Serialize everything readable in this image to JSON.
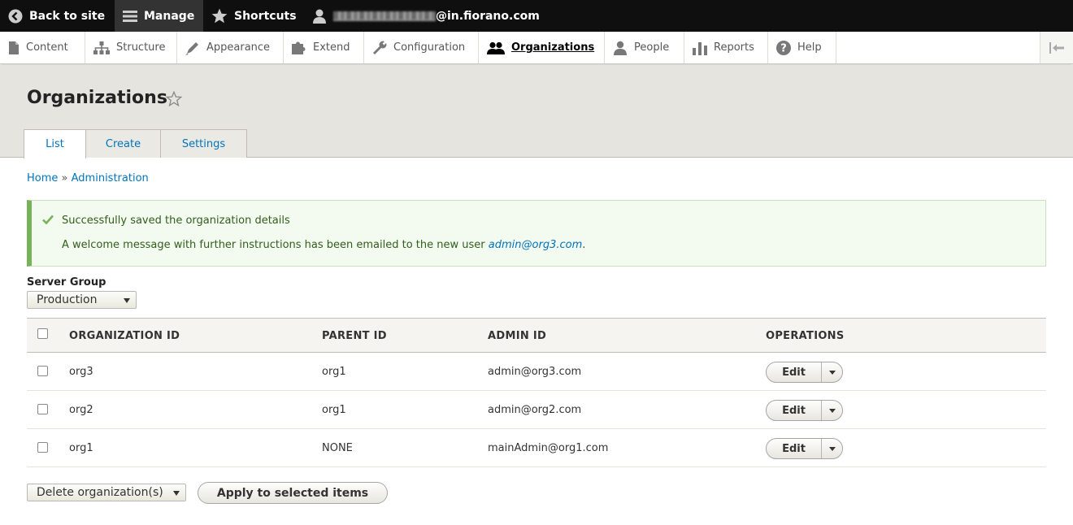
{
  "toolbar": {
    "back_label": "Back to site",
    "manage_label": "Manage",
    "shortcuts_label": "Shortcuts",
    "user_suffix": "@in.fiorano.com"
  },
  "tray": {
    "items": [
      {
        "label": "Content",
        "icon": "file-icon"
      },
      {
        "label": "Structure",
        "icon": "sitemap-icon"
      },
      {
        "label": "Appearance",
        "icon": "paintbrush-icon"
      },
      {
        "label": "Extend",
        "icon": "puzzle-icon"
      },
      {
        "label": "Configuration",
        "icon": "wrench-icon"
      },
      {
        "label": "Organizations",
        "icon": "users-icon",
        "active": true
      },
      {
        "label": "People",
        "icon": "person-icon"
      },
      {
        "label": "Reports",
        "icon": "bar-chart-icon"
      },
      {
        "label": "Help",
        "icon": "question-icon"
      }
    ]
  },
  "page": {
    "title": "Organizations",
    "tabs": [
      "List",
      "Create",
      "Settings"
    ]
  },
  "breadcrumb": {
    "home": "Home",
    "sep": "»",
    "admin": "Administration"
  },
  "message": {
    "line1": "Successfully saved the organization details",
    "line2_prefix": "A welcome message with further instructions has been emailed to the new user",
    "line2_email": "admin@org3.com",
    "line2_suffix": "."
  },
  "server_group": {
    "label": "Server Group",
    "selected": "Production"
  },
  "table": {
    "headers": [
      "ORGANIZATION ID",
      "PARENT ID",
      "ADMIN ID",
      "OPERATIONS"
    ],
    "rows": [
      {
        "org": "org3",
        "parent": "org1",
        "admin": "admin@org3.com",
        "op": "Edit"
      },
      {
        "org": "org2",
        "parent": "org1",
        "admin": "admin@org2.com",
        "op": "Edit"
      },
      {
        "org": "org1",
        "parent": "NONE",
        "admin": "mainAdmin@org1.com",
        "op": "Edit"
      }
    ]
  },
  "bulk": {
    "selected_action": "Delete organization(s)",
    "apply_label": "Apply to selected items"
  },
  "colors": {
    "link": "#0074bd",
    "success_border": "#77b259",
    "success_bg": "#f3faef",
    "toolbar_bg": "#0f0f0f"
  }
}
